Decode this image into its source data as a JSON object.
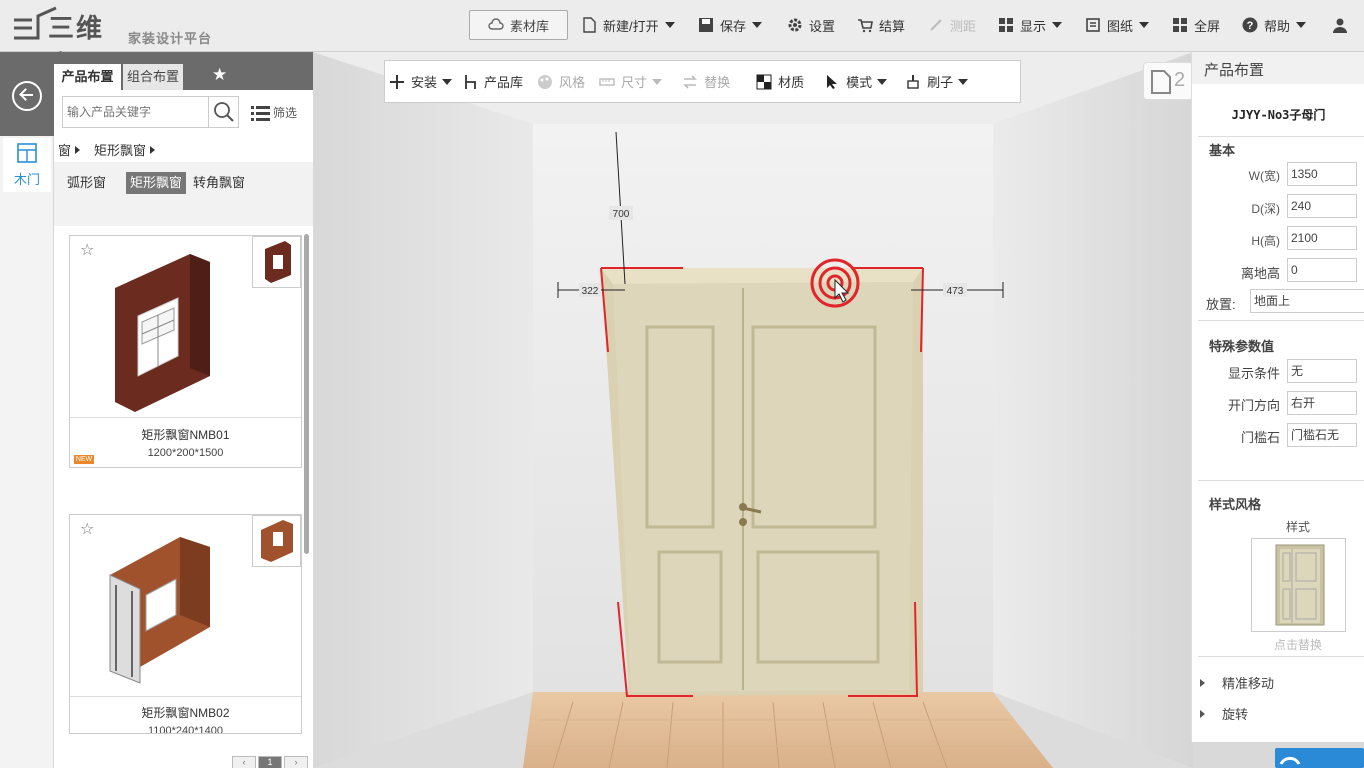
{
  "app": {
    "logo_text": "三维家",
    "platform": "家装设计平台"
  },
  "toolbar": {
    "material_lib": "素材库",
    "new_open": "新建/打开",
    "save": "保存",
    "settings": "设置",
    "checkout": "结算",
    "measure": "测距",
    "display": "显示",
    "drawings": "图纸",
    "fullscreen": "全屏",
    "help": "帮助"
  },
  "sidebar": {
    "back_icon": "back-arrow-icon",
    "category": "木门"
  },
  "library": {
    "tabs": [
      "产品布置",
      "组合布置"
    ],
    "search_placeholder": "输入产品关键字",
    "filter_label": "筛选",
    "breadcrumb": [
      "窗",
      "矩形飘窗"
    ],
    "subcategories": [
      "弧形窗",
      "矩形飘窗",
      "转角飘窗"
    ],
    "products": [
      {
        "name": "矩形飘窗NMB01",
        "size": "1200*200*1500",
        "badge": "NEW"
      },
      {
        "name": "矩形飘窗NMB02",
        "size": "1100*240*1400"
      }
    ],
    "pager_current": "1"
  },
  "canvas_tools": {
    "install": "安装",
    "product_lib": "产品库",
    "style": "风格",
    "size": "尺寸",
    "replace": "替换",
    "material": "材质",
    "mode": "模式",
    "brush": "刷子"
  },
  "scene": {
    "dim_height": "700",
    "dim_left": "322",
    "dim_right": "473",
    "view_badge": "2"
  },
  "properties": {
    "header": "产品布置",
    "title": "JJYY-No3子母门",
    "basic_section": "基本",
    "width_label": "W(宽)",
    "width": "1350",
    "depth_label": "D(深)",
    "depth": "240",
    "height_label": "H(高)",
    "height": "2100",
    "elevation_label": "离地高",
    "elevation": "0",
    "placement_label": "放置:",
    "placement": "地面上",
    "special_section": "特殊参数值",
    "display_cond_label": "显示条件",
    "display_cond": "无",
    "open_dir_label": "开门方向",
    "open_dir": "右开",
    "threshold_label": "门槛石",
    "threshold": "门槛石无",
    "style_section": "样式风格",
    "style_label": "样式",
    "replace_hint": "点击替换",
    "precise_move": "精准移动",
    "rotate": "旋转"
  },
  "colors": {
    "accent": "#2a8fd6",
    "selection": "#e0262b",
    "panel_dark": "#6b6b6b"
  }
}
